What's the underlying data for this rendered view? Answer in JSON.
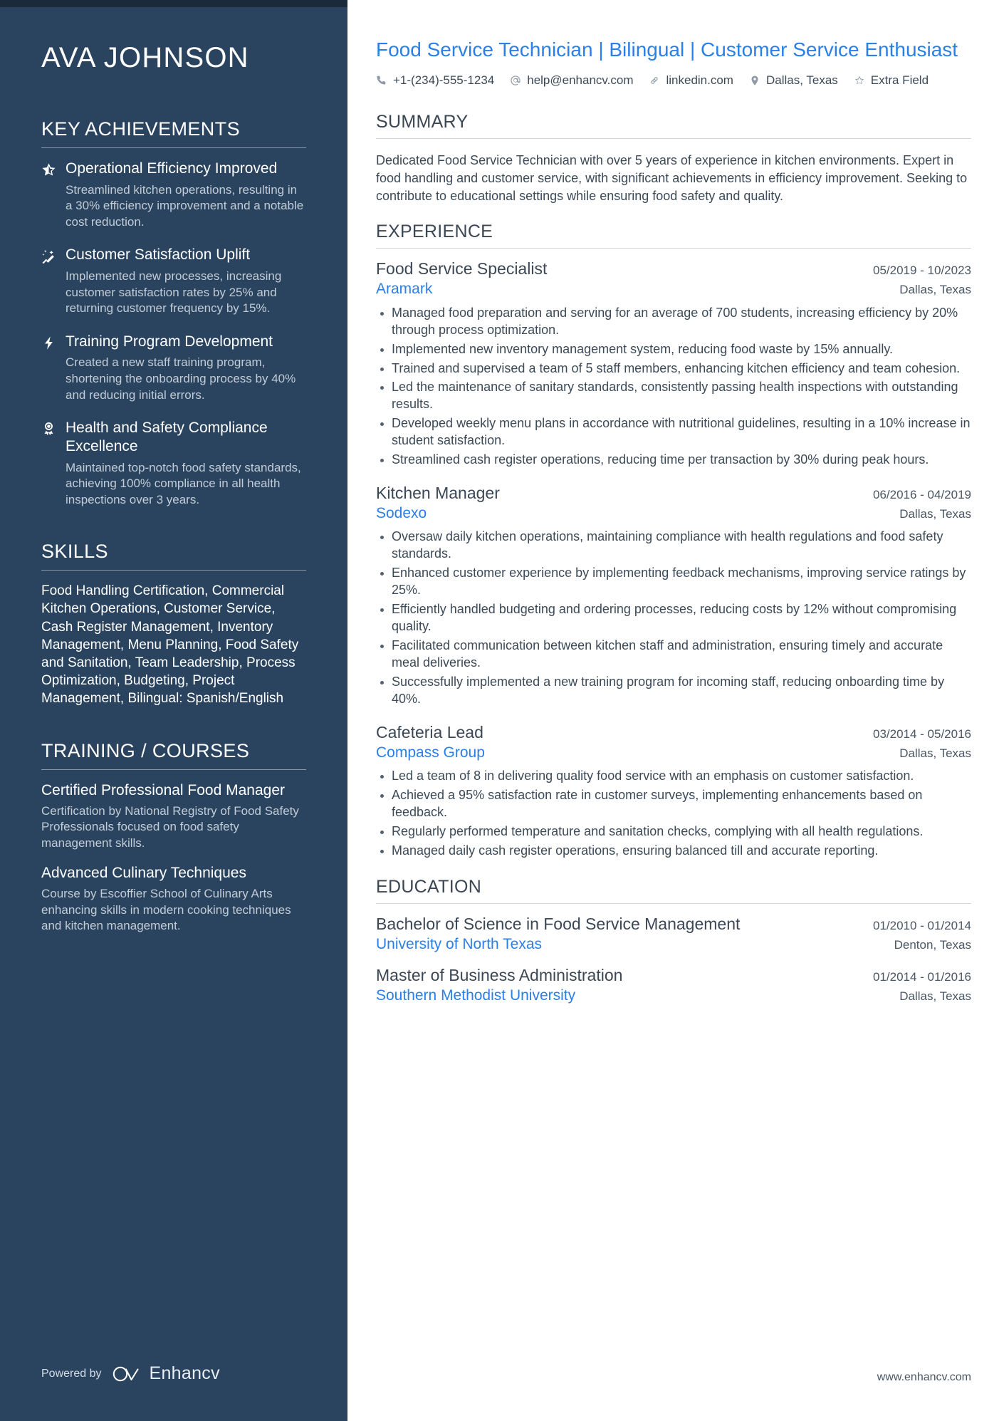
{
  "sidebar": {
    "name": "AVA JOHNSON",
    "achievements_heading": "KEY ACHIEVEMENTS",
    "achievements": [
      {
        "icon": "half-star-icon",
        "title": "Operational Efficiency Improved",
        "desc": "Streamlined kitchen operations, resulting in a 30% efficiency improvement and a notable cost reduction."
      },
      {
        "icon": "magic-wand-icon",
        "title": "Customer Satisfaction Uplift",
        "desc": "Implemented new processes, increasing customer satisfaction rates by 25% and returning customer frequency by 15%."
      },
      {
        "icon": "lightning-bolt-icon",
        "title": "Training Program Development",
        "desc": "Created a new staff training program, shortening the onboarding process by 40% and reducing initial errors."
      },
      {
        "icon": "award-ribbon-icon",
        "title": "Health and Safety Compliance Excellence",
        "desc": "Maintained top-notch food safety standards, achieving 100% compliance in all health inspections over 3 years."
      }
    ],
    "skills_heading": "SKILLS",
    "skills_text": "Food Handling Certification, Commercial Kitchen Operations, Customer Service, Cash Register Management, Inventory Management, Menu Planning, Food Safety and Sanitation, Team Leadership, Process Optimization, Budgeting, Project Management, Bilingual: Spanish/English",
    "training_heading": "TRAINING / COURSES",
    "courses": [
      {
        "title": "Certified Professional Food Manager",
        "desc": "Certification by National Registry of Food Safety Professionals focused on food safety management skills."
      },
      {
        "title": "Advanced Culinary Techniques",
        "desc": "Course by Escoffier School of Culinary Arts enhancing skills in modern cooking techniques and kitchen management."
      }
    ],
    "powered_by_label": "Powered by",
    "brand_name": "Enhancv"
  },
  "main": {
    "headline": "Food Service Technician | Bilingual | Customer Service Enthusiast",
    "contacts": [
      {
        "icon": "phone-icon",
        "value": "+1-(234)-555-1234"
      },
      {
        "icon": "email-icon",
        "value": "help@enhancv.com"
      },
      {
        "icon": "link-icon",
        "value": "linkedin.com"
      },
      {
        "icon": "location-pin-icon",
        "value": "Dallas, Texas"
      },
      {
        "icon": "star-icon",
        "value": "Extra Field"
      }
    ],
    "summary_heading": "SUMMARY",
    "summary_text": "Dedicated Food Service Technician with over 5 years of experience in kitchen environments. Expert in food handling and customer service, with significant achievements in efficiency improvement. Seeking to contribute to educational settings while ensuring food safety and quality.",
    "experience_heading": "EXPERIENCE",
    "experience": [
      {
        "title": "Food Service Specialist",
        "date": "05/2019 - 10/2023",
        "org": "Aramark",
        "location": "Dallas, Texas",
        "bullets": [
          "Managed food preparation and serving for an average of 700 students, increasing efficiency by 20% through process optimization.",
          "Implemented new inventory management system, reducing food waste by 15% annually.",
          "Trained and supervised a team of 5 staff members, enhancing kitchen efficiency and team cohesion.",
          "Led the maintenance of sanitary standards, consistently passing health inspections with outstanding results.",
          "Developed weekly menu plans in accordance with nutritional guidelines, resulting in a 10% increase in student satisfaction.",
          "Streamlined cash register operations, reducing time per transaction by 30% during peak hours."
        ]
      },
      {
        "title": "Kitchen Manager",
        "date": "06/2016 - 04/2019",
        "org": "Sodexo",
        "location": "Dallas, Texas",
        "bullets": [
          "Oversaw daily kitchen operations, maintaining compliance with health regulations and food safety standards.",
          "Enhanced customer experience by implementing feedback mechanisms, improving service ratings by 25%.",
          "Efficiently handled budgeting and ordering processes, reducing costs by 12% without compromising quality.",
          "Facilitated communication between kitchen staff and administration, ensuring timely and accurate meal deliveries.",
          "Successfully implemented a new training program for incoming staff, reducing onboarding time by 40%."
        ]
      },
      {
        "title": "Cafeteria Lead",
        "date": "03/2014 - 05/2016",
        "org": "Compass Group",
        "location": "Dallas, Texas",
        "bullets": [
          "Led a team of 8 in delivering quality food service with an emphasis on customer satisfaction.",
          "Achieved a 95% satisfaction rate in customer surveys, implementing enhancements based on feedback.",
          "Regularly performed temperature and sanitation checks, complying with all health regulations.",
          "Managed daily cash register operations, ensuring balanced till and accurate reporting."
        ]
      }
    ],
    "education_heading": "EDUCATION",
    "education": [
      {
        "degree": "Bachelor of Science in Food Service Management",
        "date": "01/2010 - 01/2014",
        "school": "University of North Texas",
        "location": "Denton, Texas"
      },
      {
        "degree": "Master of Business Administration",
        "date": "01/2014 - 01/2016",
        "school": "Southern Methodist University",
        "location": "Dallas, Texas"
      }
    ],
    "site_url": "www.enhancv.com"
  },
  "colors": {
    "sidebar_bg": "#2a4460",
    "accent_blue": "#2a7fe8",
    "body_text": "#3c4a58"
  }
}
